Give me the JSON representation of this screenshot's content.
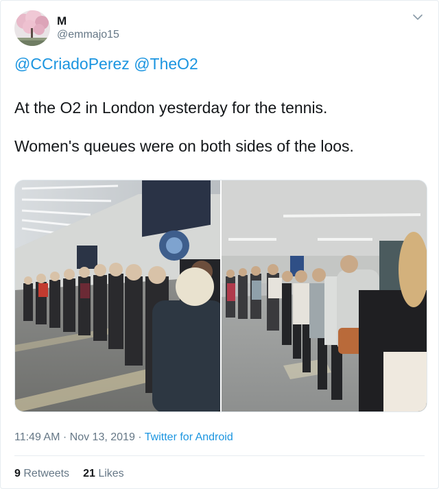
{
  "author": {
    "display_name": "M",
    "handle": "@emmajo15"
  },
  "tweet": {
    "mentions": [
      "@CCriadoPerez",
      "@TheO2"
    ],
    "text_lines": [
      "At the O2 in London yesterday for the tennis.",
      "Women's queues were on both sides of the loos."
    ],
    "time": "11:49 AM",
    "separator": "·",
    "date": "Nov 13, 2019",
    "source": "Twitter for Android"
  },
  "stats": {
    "retweets_count": "9",
    "retweets_label": "Retweets",
    "likes_count": "21",
    "likes_label": "Likes"
  },
  "icons": {
    "menu": "chevron-down-icon"
  },
  "colors": {
    "link": "#1b95e0",
    "secondary_text": "#657786",
    "primary_text": "#14171a",
    "border": "#e6ecf0"
  }
}
